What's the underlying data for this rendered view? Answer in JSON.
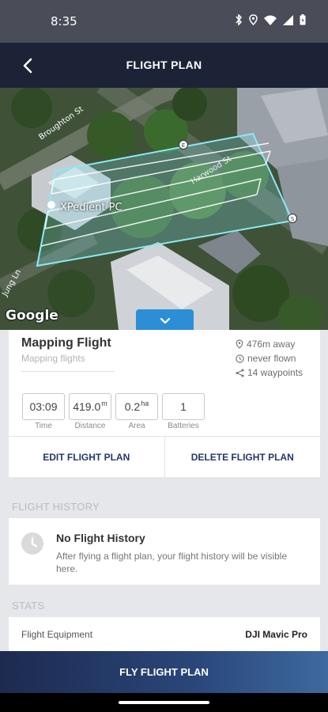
{
  "status_bar": {
    "time": "8:35"
  },
  "header": {
    "title": "FLIGHT PLAN"
  },
  "map": {
    "streets": [
      "Broughton St",
      "Harwood St",
      "Jung Ln"
    ],
    "marker_label": "XPedient PC",
    "waypoint_start": "S",
    "waypoint_end": "E",
    "attribution": "Google"
  },
  "plan": {
    "title": "Mapping Flight",
    "subtitle": "Mapping flights",
    "distance_away": "476m away",
    "last_flown": "never flown",
    "waypoints": "14 waypoints",
    "stats": [
      {
        "value": "03:09",
        "unit": "",
        "caption": "Time"
      },
      {
        "value": "419.0",
        "unit": "m",
        "caption": "Distance"
      },
      {
        "value": "0.2",
        "unit": "ha",
        "caption": "Area"
      },
      {
        "value": "1",
        "unit": "",
        "caption": "Batteries"
      }
    ],
    "edit_label": "EDIT FLIGHT PLAN",
    "delete_label": "DELETE FLIGHT PLAN"
  },
  "history": {
    "section_label": "FLIGHT HISTORY",
    "title": "No Flight History",
    "text": "After flying a flight plan, your flight history will be visible here."
  },
  "stats": {
    "section_label": "STATS",
    "equipment_label": "Flight Equipment",
    "equipment_value": "DJI Mavic Pro"
  },
  "fly_button": "FLY FLIGHT PLAN",
  "colors": {
    "header_bg": "#1d2336",
    "accent": "#2c8fd6",
    "polygon": "#7fe3f0",
    "action_text": "#23386b"
  }
}
